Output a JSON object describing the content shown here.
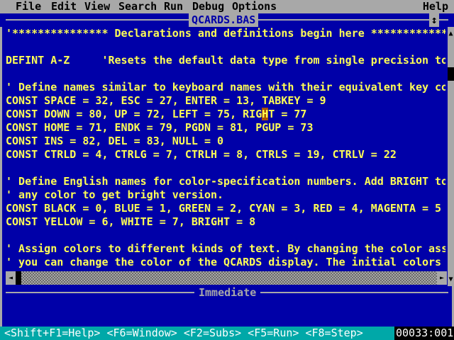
{
  "menu": [
    "File",
    "Edit",
    "View",
    "Search",
    "Run",
    "Debug",
    "Options"
  ],
  "help_label": "Help",
  "editor": {
    "title": "QCARDS.BAS",
    "maximize_glyph": "↕",
    "lines": [
      "'*************** Declarations and definitions begin here *******************",
      "",
      "DEFINT A-Z     'Resets the default data type from single precision to integer",
      "",
      "' Define names similar to keyboard names with their equivalent key codes.",
      "CONST SPACE = 32, ESC = 27, ENTER = 13, TABKEY = 9",
      "CONST DOWN = 80, UP = 72, LEFT = 75, RIGHT = 77",
      "CONST HOME = 71, ENDK = 79, PGDN = 81, PGUP = 73",
      "CONST INS = 82, DEL = 83, NULL = 0",
      "CONST CTRLD = 4, CTRLG = 7, CTRLH = 8, CTRLS = 19, CTRLV = 22",
      "",
      "' Define English names for color-specification numbers. Add BRIGHT to",
      "' any color to get bright version.",
      "CONST BLACK = 0, BLUE = 1, GREEN = 2, CYAN = 3, RED = 4, MAGENTA = 5",
      "CONST YELLOW = 6, WHITE = 7, BRIGHT = 8",
      "",
      "' Assign colors to different kinds of text. By changing the color assigned,",
      "' you can change the color of the QCARDS display. The initial colors are"
    ]
  },
  "immediate": {
    "title": "Immediate"
  },
  "status": {
    "keys": "<Shift+F1=Help> <F6=Window> <F2=Subs> <F5=Run> <F8=Step>",
    "position": "00033:001"
  },
  "colors": {
    "background": "#0000a8",
    "text": "#ffff55",
    "menubar": "#a8a8a8",
    "statusbar": "#00a8a8",
    "cursor": "#a85400"
  }
}
